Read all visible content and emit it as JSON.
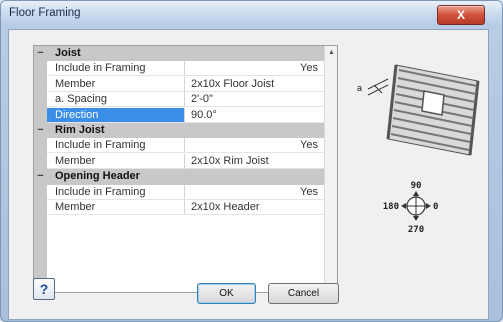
{
  "window": {
    "title": "Floor Framing",
    "close_label": "X"
  },
  "grid": {
    "sections": [
      {
        "label": "Joist",
        "toggle": "−",
        "rows": [
          {
            "name": "Include in Framing",
            "value": "Yes",
            "align": "right"
          },
          {
            "name": "Member",
            "value": "2x10x Floor Joist"
          },
          {
            "name": "a. Spacing",
            "value": "2'-0\""
          },
          {
            "name": "Direction",
            "value": "90.0°",
            "selected": true
          }
        ]
      },
      {
        "label": "Rim Joist",
        "toggle": "−",
        "rows": [
          {
            "name": "Include in Framing",
            "value": "Yes",
            "align": "right"
          },
          {
            "name": "Member",
            "value": "2x10x Rim Joist"
          }
        ]
      },
      {
        "label": "Opening Header",
        "toggle": "−",
        "rows": [
          {
            "name": "Include in Framing",
            "value": "Yes",
            "align": "right"
          },
          {
            "name": "Member",
            "value": "2x10x Header"
          }
        ]
      }
    ]
  },
  "preview": {
    "spacing_marker": "a",
    "compass": {
      "top": "90",
      "left": "180",
      "right": "0",
      "bottom": "270"
    }
  },
  "buttons": {
    "help_label": "?",
    "ok_label": "OK",
    "cancel_label": "Cancel"
  },
  "colors": {
    "selection": "#3b8ee8",
    "category_bg": "#c8c8c8",
    "close_button": "#c9452f"
  }
}
